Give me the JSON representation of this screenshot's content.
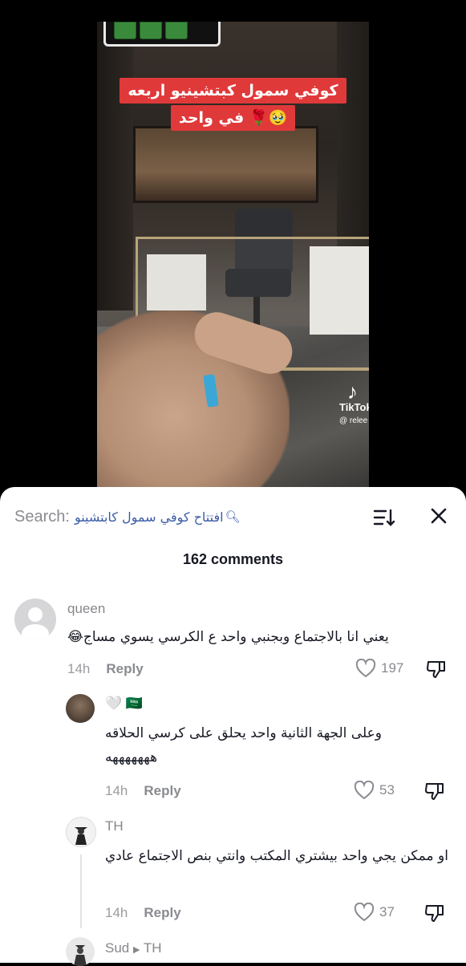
{
  "video": {
    "caption_line1": "كوفي سمول كبتشينيو اربعه",
    "caption_line2": "في واحد 🌹🥹",
    "watermark_brand": "TikTok",
    "watermark_user": "@ relee"
  },
  "search": {
    "label": "Search:",
    "term": "افتتاح كوفي سمول كابتشينو"
  },
  "comments_count": "162 comments",
  "comments": [
    {
      "username": "queen",
      "text": "يعني انا بالاجتماع وبجنبي واحد  ع الكرسي يسوي مساج😂",
      "time": "14h",
      "reply_label": "Reply",
      "likes": "197"
    },
    {
      "username": "🤍 🇸🇦",
      "text": "وعلى الجهة الثانية واحد يحلق على كرسي الحلاقه هههههههه",
      "time": "14h",
      "reply_label": "Reply",
      "likes": "53"
    },
    {
      "username": "TH",
      "text": "او ممكن يجي واحد بيشتري المكتب وانتي بنص الاجتماع عادي",
      "time": "14h",
      "reply_label": "Reply",
      "likes": "37"
    },
    {
      "username": "Sud",
      "reply_to": "TH"
    }
  ],
  "colors": {
    "caption_bg": "#e0393a",
    "search_term": "#3a5ba6",
    "text_primary": "#161823",
    "text_secondary": "#8a8b90"
  }
}
